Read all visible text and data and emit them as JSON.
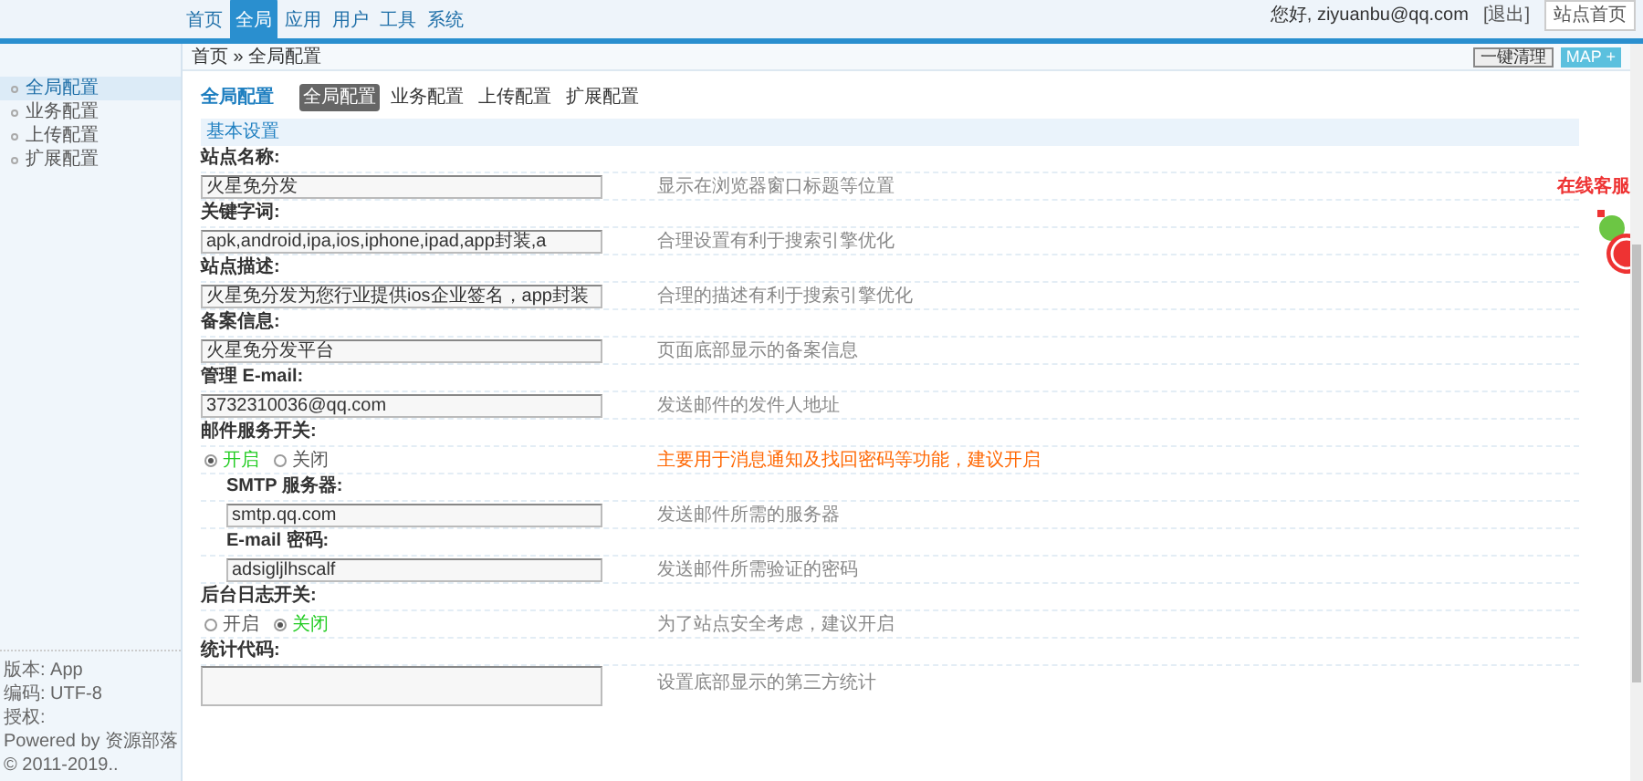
{
  "nav": {
    "tabs": [
      {
        "label": "首页",
        "selected": false
      },
      {
        "label": "全局",
        "selected": true
      },
      {
        "label": "应用",
        "selected": false
      },
      {
        "label": "用户",
        "selected": false
      },
      {
        "label": "工具",
        "selected": false
      },
      {
        "label": "系统",
        "selected": false
      }
    ],
    "greeting": "您好, ziyuanbu@qq.com",
    "logout": "[退出]",
    "home_link": "站点首页"
  },
  "breadcrumb": "首页 » 全局配置",
  "toolbar_buttons": [
    "一键清理",
    "MAP +"
  ],
  "sidebar": {
    "items": [
      {
        "label": "全局配置",
        "selected": true
      },
      {
        "label": "业务配置",
        "selected": false
      },
      {
        "label": "上传配置",
        "selected": false
      },
      {
        "label": "扩展配置",
        "selected": false
      }
    ],
    "footer": [
      "版本: App",
      "编码: UTF-8",
      "授权:",
      "Powered by 资源部落",
      "© 2011-2019.."
    ]
  },
  "page_title": "全局配置",
  "tabs": [
    {
      "label": "全局配置",
      "selected": true
    },
    {
      "label": "业务配置",
      "selected": false
    },
    {
      "label": "上传配置",
      "selected": false
    },
    {
      "label": "扩展配置",
      "selected": false
    }
  ],
  "section": "基本设置",
  "rows": [
    {
      "kind": "input",
      "label": "站点名称:",
      "value": "火星免分发",
      "hint": "显示在浏览器窗口标题等位置"
    },
    {
      "kind": "input",
      "label": "关键字词:",
      "value": "apk,android,ipa,ios,iphone,ipad,app封装,a",
      "hint": "合理设置有利于搜索引擎优化"
    },
    {
      "kind": "input",
      "label": "站点描述:",
      "value": "火星免分发为您行业提供ios企业签名，app封装",
      "hint": "合理的描述有利于搜索引擎优化"
    },
    {
      "kind": "input",
      "label": "备案信息:",
      "value": "火星免分发平台",
      "hint": "页面底部显示的备案信息"
    },
    {
      "kind": "input",
      "label": "管理 E-mail:",
      "value": "3732310036@qq.com",
      "hint": "发送邮件的发件人地址"
    },
    {
      "kind": "radio",
      "label": "邮件服务开关:",
      "options": [
        {
          "label": "开启",
          "selected": true
        },
        {
          "label": "关闭",
          "selected": false
        }
      ],
      "hint": "主要用于消息通知及找回密码等功能，建议开启",
      "warning": true
    },
    {
      "kind": "input",
      "sub": true,
      "label": "SMTP 服务器:",
      "value": "smtp.qq.com",
      "hint": "发送邮件所需的服务器"
    },
    {
      "kind": "input",
      "sub": true,
      "label": "E-mail 密码:",
      "value": "adsigljlhscalf",
      "hint": "发送邮件所需验证的密码"
    },
    {
      "kind": "radio",
      "label": "后台日志开关:",
      "options": [
        {
          "label": "开启",
          "selected": false
        },
        {
          "label": "关闭",
          "selected": true
        }
      ],
      "hint": "为了站点安全考虑，建议开启",
      "warning": false
    },
    {
      "kind": "textarea",
      "label": "统计代码:",
      "hint": "设置底部显示的第三方统计"
    }
  ],
  "widget": {
    "label": "在线客服"
  }
}
